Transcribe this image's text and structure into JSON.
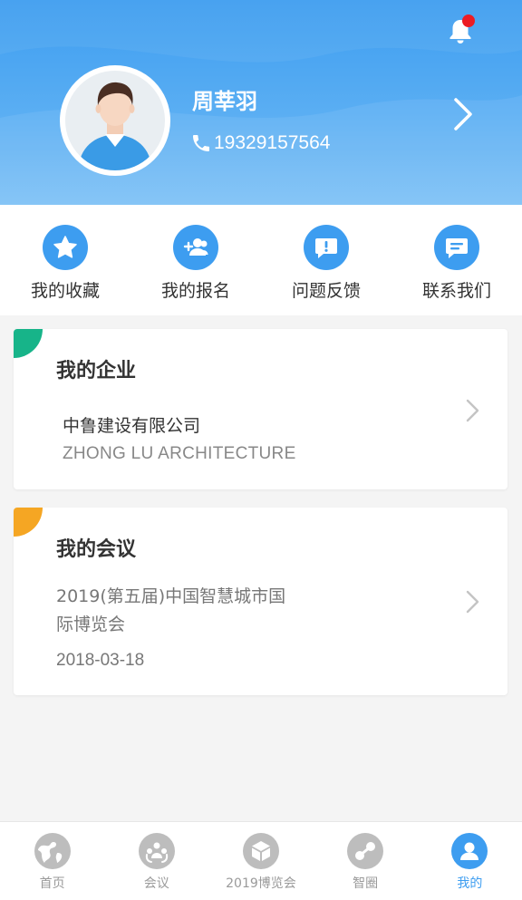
{
  "profile": {
    "name": "周莘羽",
    "phone": "19329157564"
  },
  "quick_actions": [
    {
      "label": "我的收藏",
      "icon": "star-icon"
    },
    {
      "label": "我的报名",
      "icon": "add-user-icon"
    },
    {
      "label": "问题反馈",
      "icon": "feedback-icon"
    },
    {
      "label": "联系我们",
      "icon": "message-icon"
    }
  ],
  "enterprise": {
    "title": "我的企业",
    "company_cn": "中鲁建设有限公司",
    "company_en": "ZHONG LU ARCHITECTURE",
    "accent": "#17b489"
  },
  "meeting": {
    "title": "我的会议",
    "name_line1": "2019(第五届)中国智慧城市国",
    "name_line2": "际博览会",
    "date": "2018-03-18",
    "accent": "#f5a623"
  },
  "tabs": [
    {
      "label": "首页",
      "icon": "globe-icon"
    },
    {
      "label": "会议",
      "icon": "meeting-icon"
    },
    {
      "label": "2019博览会",
      "icon": "cube-icon"
    },
    {
      "label": "智圈",
      "icon": "circle-icon"
    },
    {
      "label": "我的",
      "icon": "user-icon"
    }
  ],
  "colors": {
    "primary": "#3d9df0",
    "notification_dot": "#ec1c24"
  }
}
